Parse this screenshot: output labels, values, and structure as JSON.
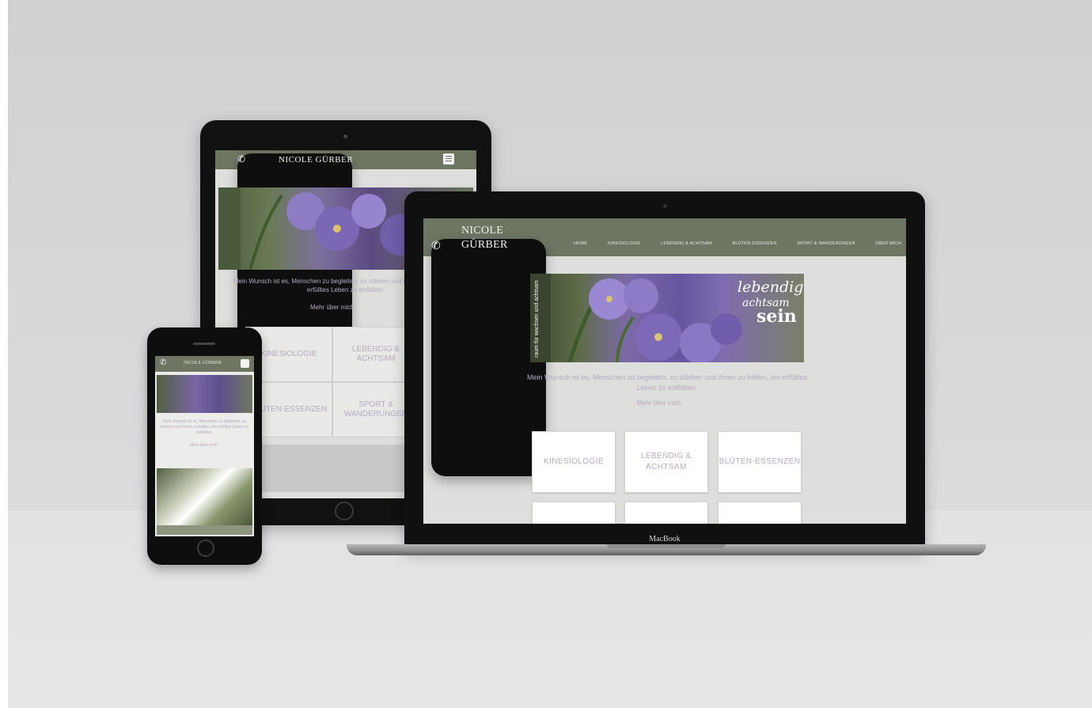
{
  "site": {
    "name": "NICOLE GÜRBER",
    "name_line1": "NICOLE",
    "name_line2": "GÜRBER",
    "nav": [
      "HOME",
      "KINESIOLOGIE",
      "LEBENDIG & ACHTSAM",
      "BLÜTEN-ESSENZEN",
      "SPORT & WANDERUNGEN",
      "ÜBER MICH"
    ],
    "banner": {
      "side_tag": "raum für wachsen und achtsam",
      "line1": "lebendig",
      "line2": "achtsam",
      "line3": "sein"
    },
    "intro": "Mein Wunsch ist es, Menschen zu begleiten, zu stärken und ihnen zu helfen, ein erfülltes Leben zu entfalten.",
    "more": "Mehr über mich",
    "cards": [
      {
        "label": "KINESIOLOGIE"
      },
      {
        "label": "LEBENDIG & ACHTSAM"
      },
      {
        "label": "BLÜTEN-ESSENZEN"
      }
    ],
    "tablet_cells": [
      {
        "label": "KINESIOLOGIE"
      },
      {
        "label": "LEBENDIG & ACHTSAM"
      },
      {
        "label": "SPORT & WANDERUNGEN"
      },
      {
        "label": "BLÜTEN-ESSENZEN"
      }
    ]
  },
  "device": {
    "laptop_brand": "MacBook"
  }
}
